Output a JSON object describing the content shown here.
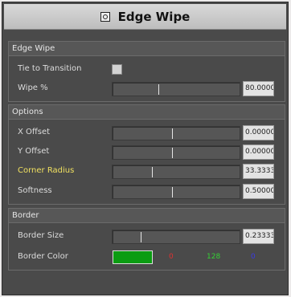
{
  "window": {
    "title": "Edge Wipe"
  },
  "sections": {
    "edge_wipe": {
      "header": "Edge Wipe",
      "tie_to_transition": {
        "label": "Tie to Transition",
        "checked": false
      },
      "wipe_percent": {
        "label": "Wipe %",
        "value": "80.0000",
        "fraction": 0.36
      }
    },
    "options": {
      "header": "Options",
      "x_offset": {
        "label": "X Offset",
        "value": "0.00000",
        "fraction": 0.47
      },
      "y_offset": {
        "label": "Y Offset",
        "value": "0.00000",
        "fraction": 0.47
      },
      "corner_radius": {
        "label": "Corner Radius",
        "value": "33.3333",
        "fraction": 0.31
      },
      "softness": {
        "label": "Softness",
        "value": "0.50000",
        "fraction": 0.47
      }
    },
    "border": {
      "header": "Border",
      "border_size": {
        "label": "Border Size",
        "value": "0.23333",
        "fraction": 0.22
      },
      "border_color": {
        "label": "Border Color",
        "swatch": "#0b9c12",
        "r": "0",
        "g": "128",
        "b": "0",
        "r_color": "#e03030",
        "g_color": "#35d035",
        "b_color": "#3a3ae6"
      }
    }
  }
}
